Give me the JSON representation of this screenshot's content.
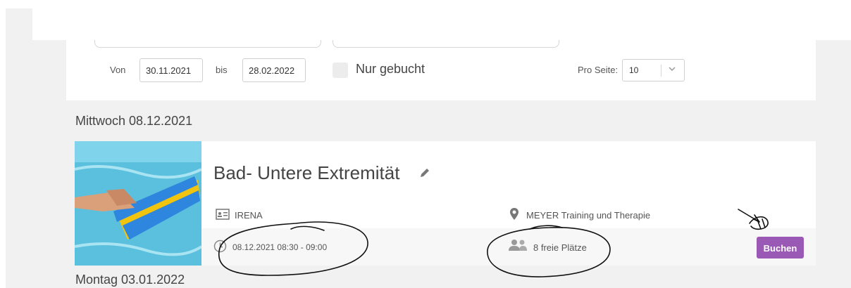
{
  "filters": {
    "from_label": "Von",
    "from_value": "30.11.2021",
    "to_label": "bis",
    "to_value": "28.02.2022",
    "only_booked_label": "Nur gebucht",
    "per_page_label": "Pro Seite:",
    "per_page_value": "10"
  },
  "days": [
    {
      "heading": "Mittwoch 08.12.2021",
      "event": {
        "title": "Bad- Untere Extremität",
        "trainer": "IRENA",
        "location": "MEYER Training und Therapie",
        "datetime": "08.12.2021 08:30 - 09:00",
        "free_spots": "8 freie Plätze",
        "book_label": "Buchen"
      }
    },
    {
      "heading": "Montag 03.01.2022"
    }
  ],
  "colors": {
    "accent": "#9b59b6",
    "background": "#f1f1f1",
    "card": "#ffffff",
    "water": "#5bc0de"
  },
  "icons": [
    "edit-icon",
    "id-card-icon",
    "location-pin-icon",
    "clock-icon",
    "users-icon",
    "chevron-down-icon"
  ]
}
